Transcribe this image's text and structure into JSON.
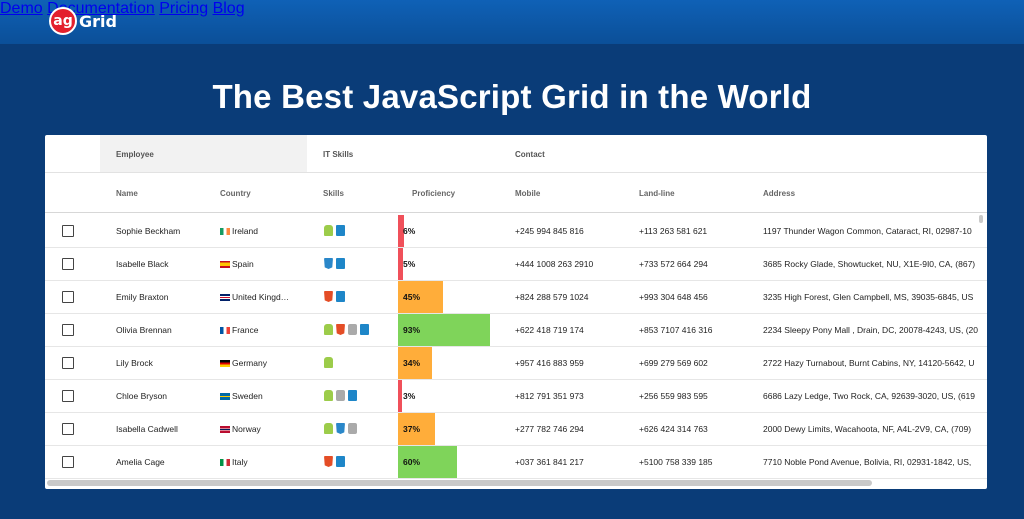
{
  "header": {
    "logo_text_ag": "ag",
    "logo_text_grid": "Grid",
    "nav": [
      "Demo",
      "Documentation",
      "Pricing",
      "Blog"
    ]
  },
  "hero": {
    "title": "The Best JavaScript Grid in the World"
  },
  "grid": {
    "groups": [
      "Employee",
      "IT Skills",
      "Contact"
    ],
    "columns": [
      "Name",
      "Country",
      "Skills",
      "Proficiency",
      "Mobile",
      "Land-line",
      "Address"
    ],
    "colors": {
      "low": "#f0505a",
      "mid": "#ffad3a",
      "high": "#7fd45a"
    },
    "rows": [
      {
        "name": "Sophie Beckham",
        "country": "Ireland",
        "flag": "ireland",
        "skills": [
          "android-icon",
          "windows-icon"
        ],
        "proficiency": "6%",
        "proficiency_value": 6,
        "mobile": "+245 994 845 816",
        "landline": "+113 263 581 621",
        "address": "1197 Thunder Wagon Common, Cataract, RI, 02987-10"
      },
      {
        "name": "Isabelle Black",
        "country": "Spain",
        "flag": "spain",
        "skills": [
          "css-icon",
          "windows-icon"
        ],
        "proficiency": "5%",
        "proficiency_value": 5,
        "mobile": "+444 1008 263 2910",
        "landline": "+733 572 664 294",
        "address": "3685 Rocky Glade, Showtucket, NU, X1E-9I0, CA, (867)"
      },
      {
        "name": "Emily Braxton",
        "country": "United Kingd…",
        "flag": "uk",
        "skills": [
          "html-icon",
          "windows-icon"
        ],
        "proficiency": "45%",
        "proficiency_value": 45,
        "mobile": "+824 288 579 1024",
        "landline": "+993 304 648 456",
        "address": "3235 High Forest, Glen Campbell, MS, 39035-6845, US"
      },
      {
        "name": "Olivia Brennan",
        "country": "France",
        "flag": "france",
        "skills": [
          "android-icon",
          "html-icon",
          "mac-icon",
          "windows-icon"
        ],
        "proficiency": "93%",
        "proficiency_value": 93,
        "mobile": "+622 418 719 174",
        "landline": "+853 7107 416 316",
        "address": "2234 Sleepy Pony Mall , Drain, DC, 20078-4243, US, (20"
      },
      {
        "name": "Lily Brock",
        "country": "Germany",
        "flag": "germany",
        "skills": [
          "android-icon"
        ],
        "proficiency": "34%",
        "proficiency_value": 34,
        "mobile": "+957 416 883 959",
        "landline": "+699 279 569 602",
        "address": "2722 Hazy Turnabout, Burnt Cabins, NY, 14120-5642, U"
      },
      {
        "name": "Chloe Bryson",
        "country": "Sweden",
        "flag": "sweden",
        "skills": [
          "android-icon",
          "mac-icon",
          "windows-icon"
        ],
        "proficiency": "3%",
        "proficiency_value": 3,
        "mobile": "+812 791 351 973",
        "landline": "+256 559 983 595",
        "address": "6686 Lazy Ledge, Two Rock, CA, 92639-3020, US, (619"
      },
      {
        "name": "Isabella Cadwell",
        "country": "Norway",
        "flag": "norway",
        "skills": [
          "android-icon",
          "css-icon",
          "mac-icon"
        ],
        "proficiency": "37%",
        "proficiency_value": 37,
        "mobile": "+277 782 746 294",
        "landline": "+626 424 314 763",
        "address": "2000 Dewy Limits, Wacahoota, NF, A4L-2V9, CA, (709)"
      },
      {
        "name": "Amelia Cage",
        "country": "Italy",
        "flag": "italy",
        "skills": [
          "html-icon",
          "windows-icon"
        ],
        "proficiency": "60%",
        "proficiency_value": 60,
        "mobile": "+037 361 841 217",
        "landline": "+5100 758 339 185",
        "address": "7710 Noble Pond Avenue, Bolivia, RI, 02931-1842, US,"
      }
    ]
  }
}
